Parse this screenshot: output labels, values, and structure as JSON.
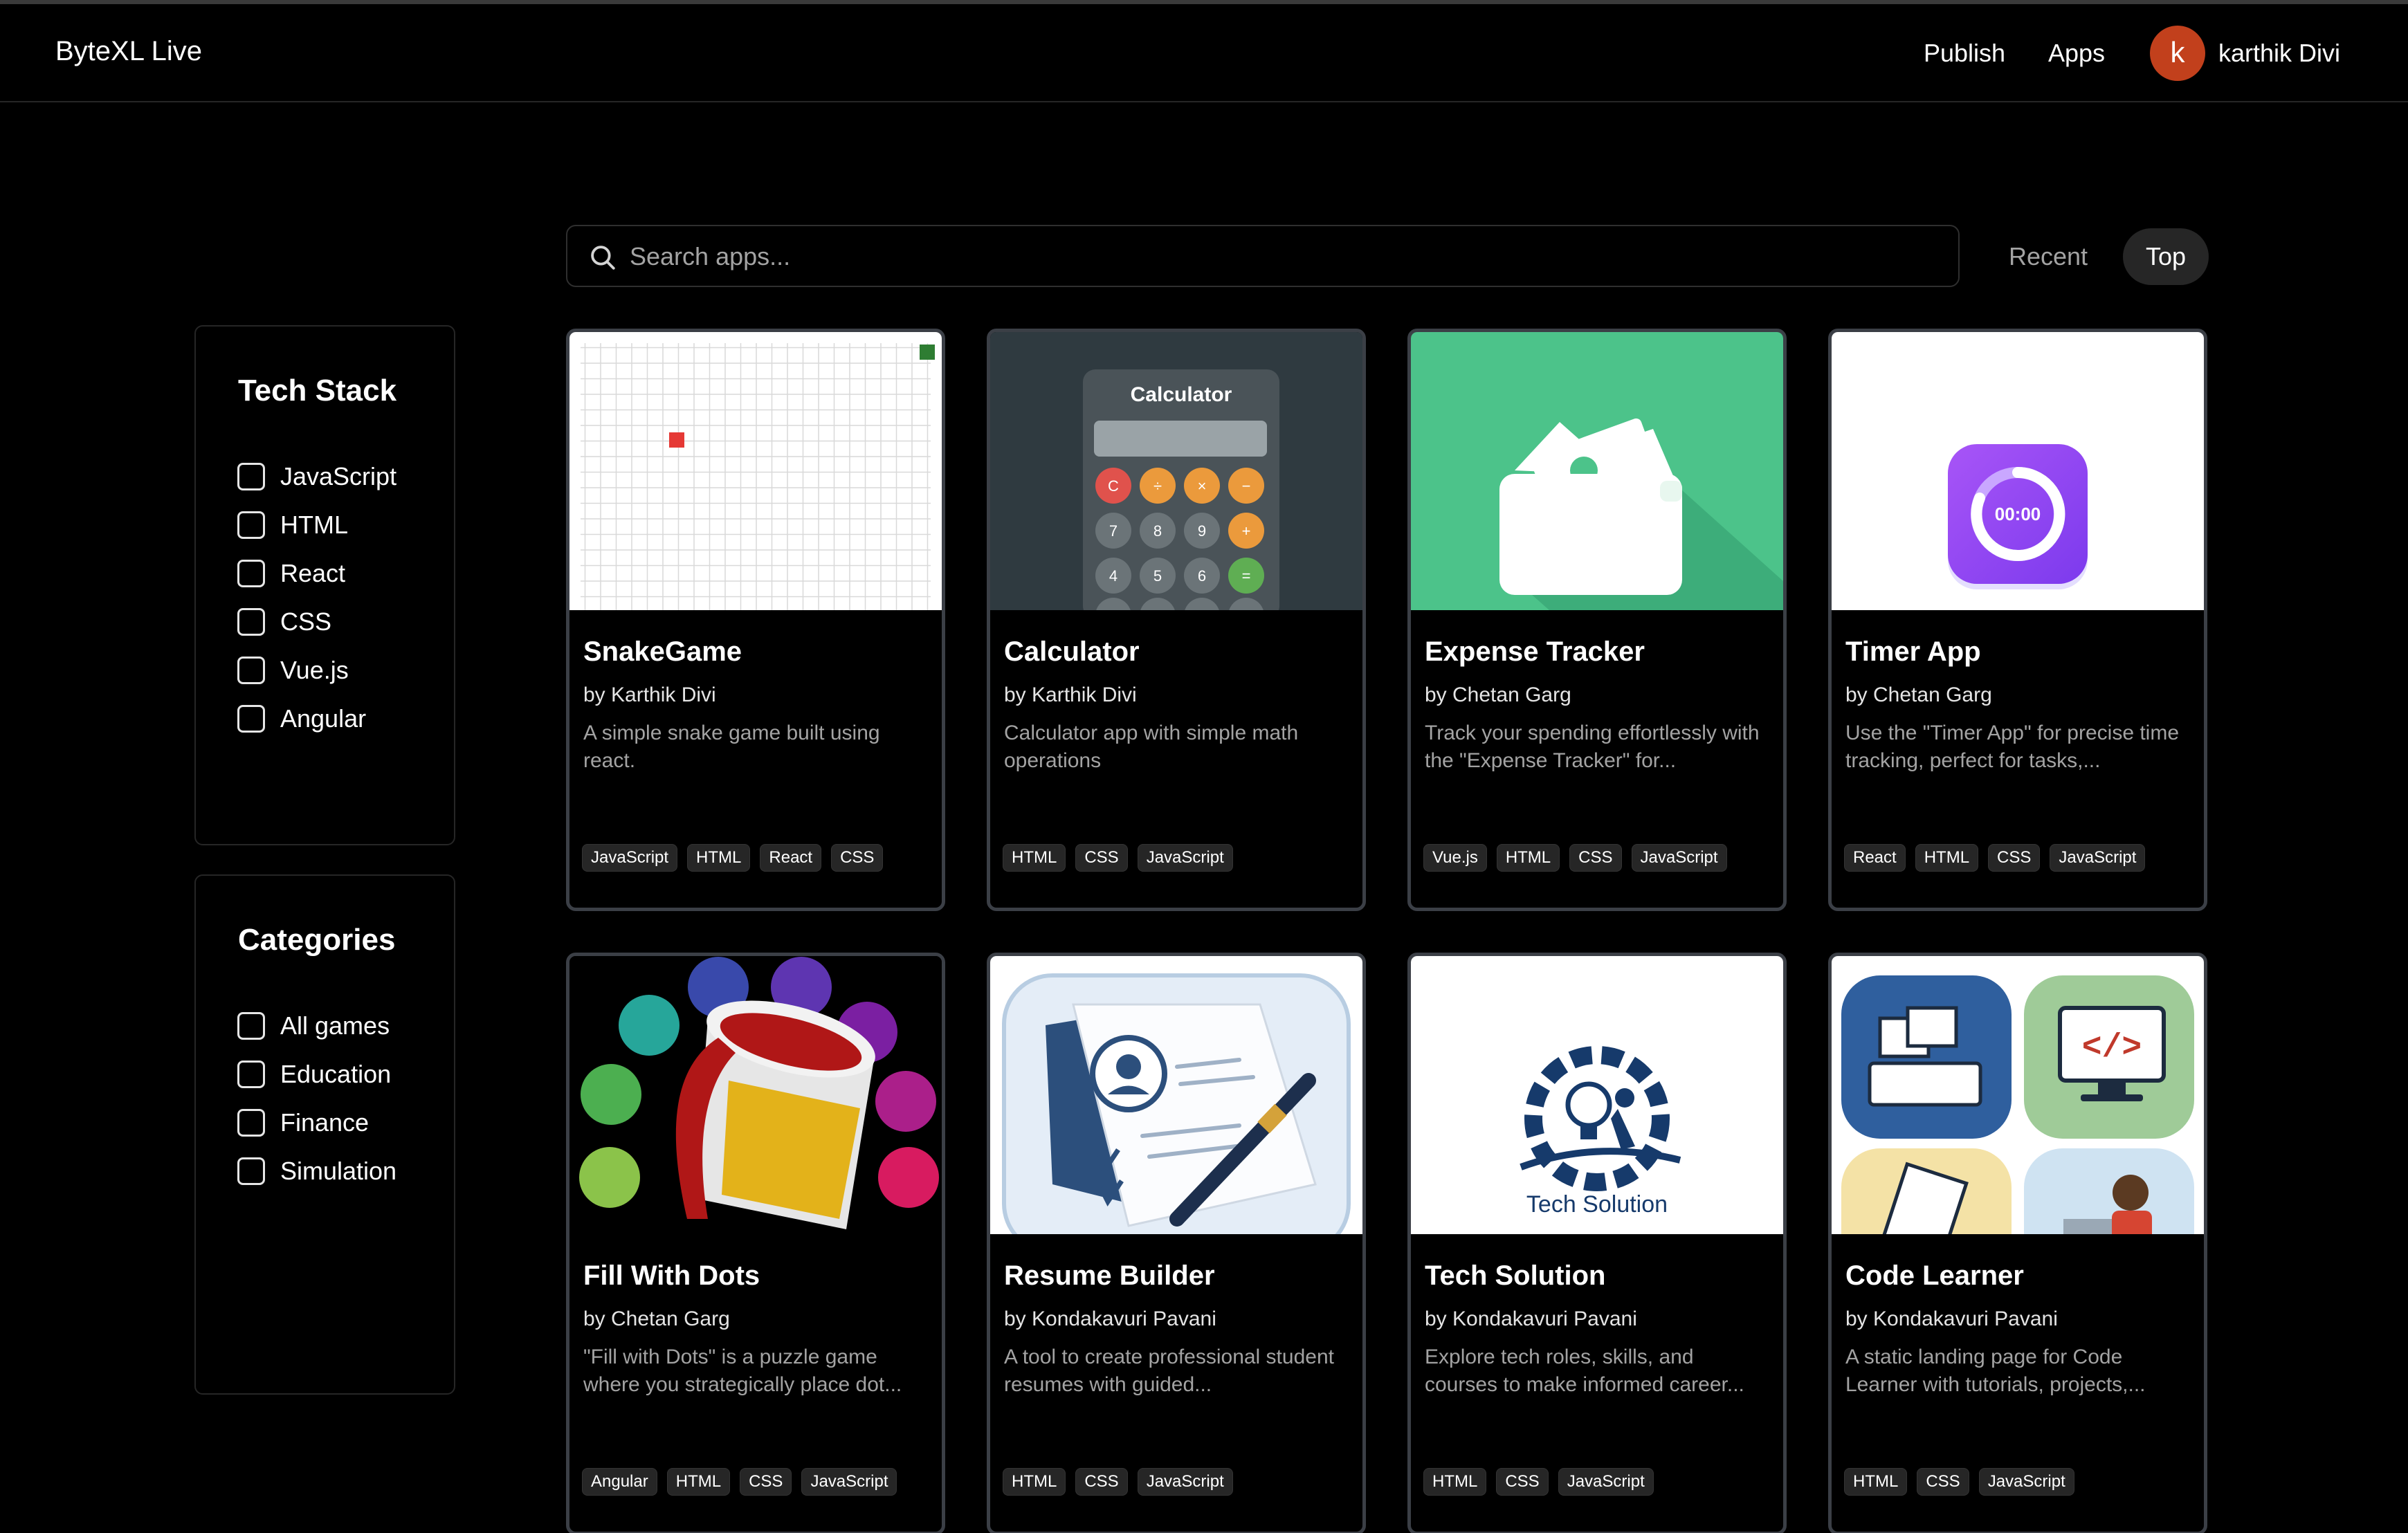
{
  "navbar": {
    "brand": "ByteXL Live",
    "publish": "Publish",
    "apps": "Apps",
    "avatar_initial": "k",
    "user_name": "karthik Divi"
  },
  "search": {
    "placeholder": "Search apps...",
    "value": ""
  },
  "sort": {
    "recent": "Recent",
    "top": "Top",
    "active": "Top"
  },
  "tech_stack": {
    "title": "Tech Stack",
    "items": [
      "JavaScript",
      "HTML",
      "React",
      "CSS",
      "Vue.js",
      "Angular"
    ]
  },
  "categories": {
    "title": "Categories",
    "items": [
      "All games",
      "Education",
      "Finance",
      "Simulation"
    ]
  },
  "apps": [
    {
      "title": "SnakeGame",
      "author": "by Karthik Divi",
      "description": "A simple snake game built using react.",
      "tags": [
        "JavaScript",
        "HTML",
        "React",
        "CSS"
      ]
    },
    {
      "title": "Calculator",
      "author": "by Karthik Divi",
      "description": "Calculator app with simple math operations",
      "tags": [
        "HTML",
        "CSS",
        "JavaScript"
      ]
    },
    {
      "title": "Expense Tracker",
      "author": "by Chetan Garg",
      "description": "Track your spending effortlessly with the \"Expense Tracker\" for...",
      "tags": [
        "Vue.js",
        "HTML",
        "CSS",
        "JavaScript"
      ]
    },
    {
      "title": "Timer App",
      "author": "by Chetan Garg",
      "description": "Use the \"Timer App\" for precise time tracking, perfect for tasks,...",
      "tags": [
        "React",
        "HTML",
        "CSS",
        "JavaScript"
      ]
    },
    {
      "title": "Fill With Dots",
      "author": "by Chetan Garg",
      "description": "\"Fill with Dots\" is a puzzle game where you strategically place dot...",
      "tags": [
        "Angular",
        "HTML",
        "CSS",
        "JavaScript"
      ]
    },
    {
      "title": "Resume Builder",
      "author": "by Kondakavuri Pavani",
      "description": "A tool to create professional student resumes with guided...",
      "tags": [
        "HTML",
        "CSS",
        "JavaScript"
      ]
    },
    {
      "title": "Tech Solution",
      "author": "by Kondakavuri Pavani",
      "description": "Explore tech roles, skills, and courses to make informed career...",
      "tags": [
        "HTML",
        "CSS",
        "JavaScript"
      ]
    },
    {
      "title": "Code Learner",
      "author": "by Kondakavuri Pavani",
      "description": "A static landing page for Code Learner with tutorials, projects,...",
      "tags": [
        "HTML",
        "CSS",
        "JavaScript"
      ]
    }
  ],
  "thumbnails": {
    "calculator_title": "Calculator",
    "calculator_keys": [
      "C",
      "÷",
      "×",
      "−",
      "7",
      "8",
      "9",
      "+",
      "4",
      "5",
      "6",
      "="
    ],
    "timer_display": "00:00",
    "tech_solution_logo_text": "Tech Solution"
  },
  "colors": {
    "accent_avatar": "#c2401c",
    "card_border": "#3b3f46",
    "tag_bg": "#262626",
    "expense_green": "#4cc38a",
    "timer_purple": "#8b3cf6"
  }
}
